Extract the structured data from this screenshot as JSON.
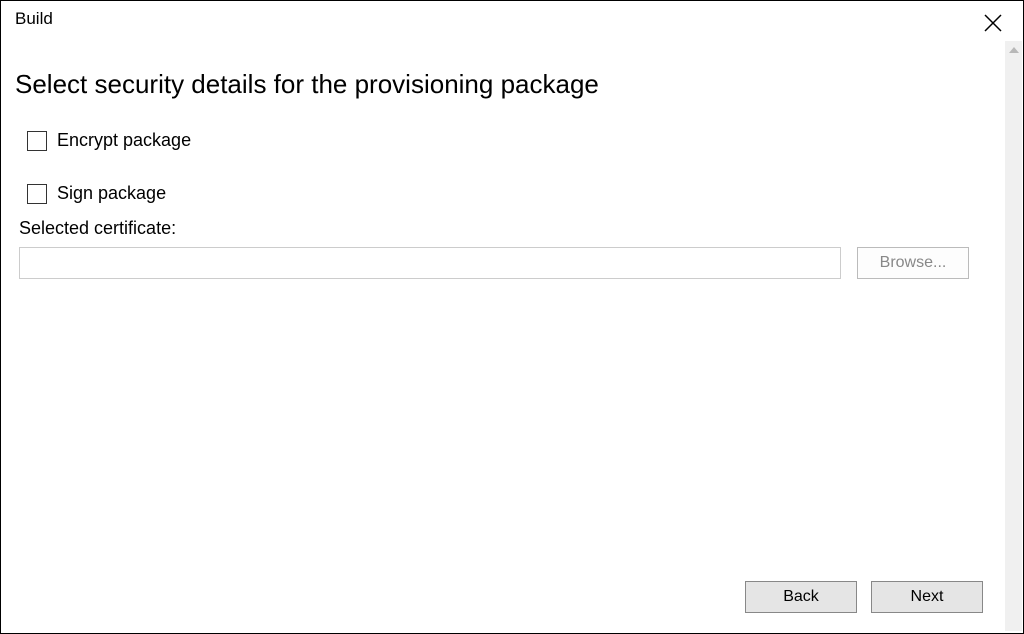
{
  "window": {
    "title": "Build"
  },
  "page": {
    "heading": "Select security details for the provisioning package"
  },
  "options": {
    "encrypt_label": "Encrypt package",
    "encrypt_checked": false,
    "sign_label": "Sign package",
    "sign_checked": false
  },
  "certificate": {
    "label": "Selected certificate:",
    "value": "",
    "browse_label": "Browse..."
  },
  "footer": {
    "back_label": "Back",
    "next_label": "Next"
  }
}
